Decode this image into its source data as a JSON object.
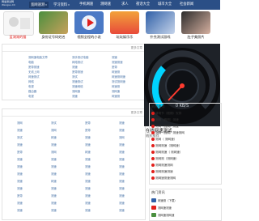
{
  "header": {
    "logo_line1": "网速测试网",
    "logo_line2": "Wangsu.CC",
    "nav": [
      {
        "label": "宽网速测"
      },
      {
        "label": "学习资料"
      },
      {
        "label": "手机网速"
      },
      {
        "label": "测网速"
      },
      {
        "label": "求人"
      },
      {
        "label": "夜话大全"
      },
      {
        "label": "城市大全"
      },
      {
        "label": "社会新闻"
      }
    ]
  },
  "promos": [
    {
      "caption": "蓝湖湖的猫"
    },
    {
      "caption": "身份证号码姓名"
    },
    {
      "caption": "视频全程的小说"
    },
    {
      "caption": "玩玩娱乐乐"
    },
    {
      "caption": "扑克测试游戏"
    },
    {
      "caption": "肚子美照片"
    }
  ],
  "links_panel_top": {
    "more": "更多文章",
    "col1": [
      "测网速电脑文章",
      "电脑",
      "宽带测速",
      "无线上网",
      "网速测试",
      "网络",
      "电视",
      "路由器",
      "电视"
    ],
    "col2": [
      "测手测试电脑",
      "网络测试",
      "测速",
      "宽带测速",
      "测试",
      "测速测试",
      "测速网络",
      "测网速",
      "测速"
    ],
    "col3": [
      "测速",
      "测速测速",
      "宽带",
      "网速测",
      "网速测网速",
      "测试测网速",
      "网速测",
      "测网速",
      "网速测"
    ]
  },
  "links_panel_bottom": {
    "more": "更多文章",
    "col1": [
      "测网",
      "测速",
      "测试",
      "测速",
      "宽带",
      "测速",
      "测速",
      "测速",
      "测速",
      "测速",
      "宽带",
      "测速",
      "测速"
    ],
    "col2": [
      "测试",
      "测网",
      "网速",
      "测速",
      "测网",
      "测速",
      "测速",
      "测速",
      "网速",
      "测速",
      "测速",
      "测速",
      "测速"
    ],
    "col3": [
      "宽带",
      "宽带",
      "测速",
      "测速",
      "网速",
      "测速",
      "测速",
      "测速",
      "测速",
      "测速",
      "测速",
      "测速",
      "测速"
    ],
    "col4": [
      "测速",
      "测速",
      "测网",
      "测速",
      "测速",
      "测速",
      "测速",
      "测速",
      "测速",
      "测速",
      "测速",
      "测速",
      "测速"
    ]
  },
  "speed": {
    "title": "在线网速测试",
    "subtitle": "随机推荐",
    "readout": "0 KB/S"
  },
  "recommend": {
    "items": [
      "清明节（假期）安排",
      "测网（假期）测速",
      "测网（假期）测速",
      "测网（假期）测速测网",
      "测网（ 测网速）",
      "测网测速（测网速）",
      "测网测速（ 测网速）",
      "测网测（测网速）",
      "测网测速测网",
      "测网测速测速",
      "测网速测速测网"
    ]
  },
  "bottom": {
    "title": "热门资讯",
    "items": [
      "网速测（下载）",
      "测网速测速",
      "测网速测网速"
    ]
  },
  "colors": {
    "topbar": "#2b4f86",
    "accent_red": "#e2201c",
    "link_blue": "#4a74a8"
  }
}
